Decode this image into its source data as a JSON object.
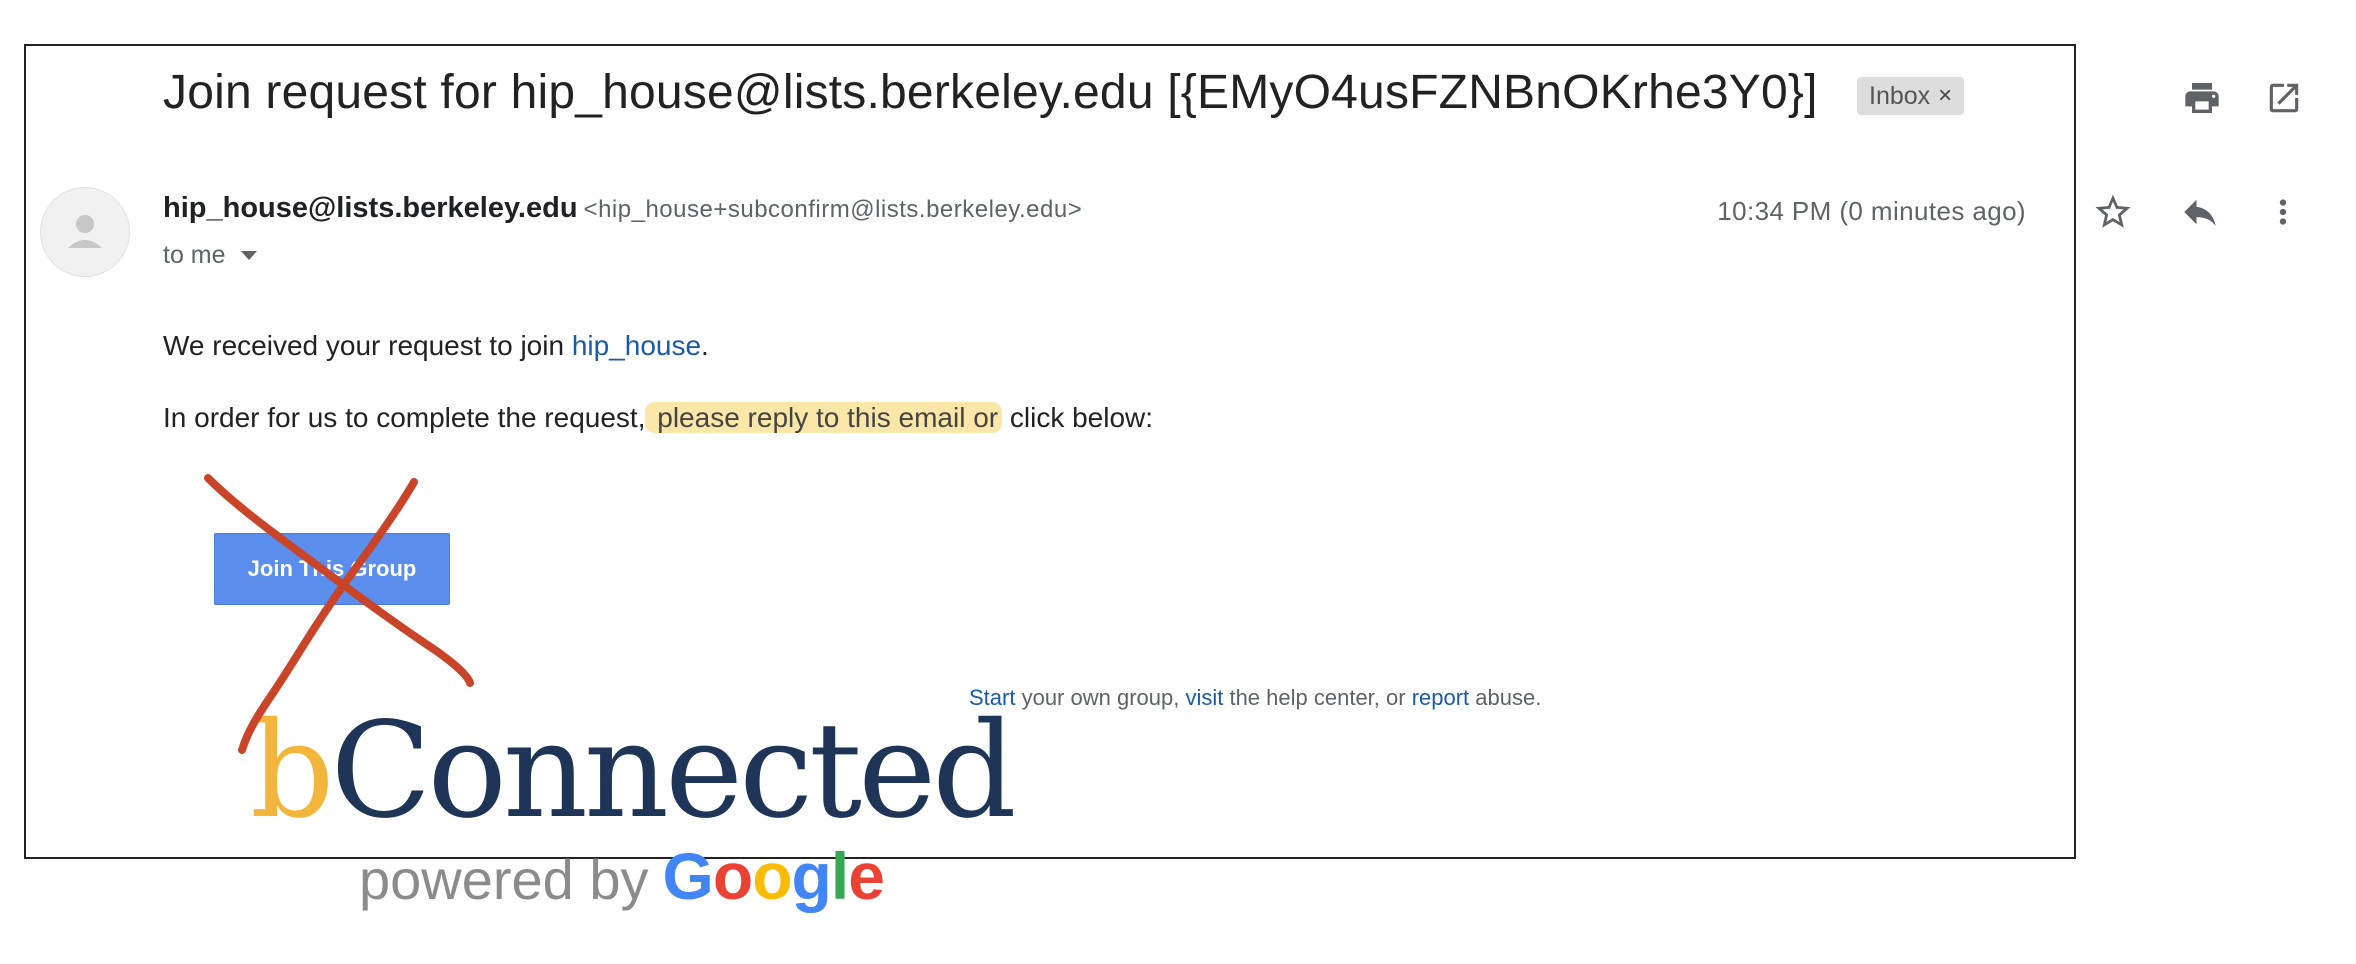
{
  "email": {
    "subject": "Join request for hip_house@lists.berkeley.edu [{EMyO4usFZNBnOKrhe3Y0}]",
    "label_chip": {
      "label": "Inbox",
      "close": "×"
    },
    "sender": {
      "name": "hip_house@lists.berkeley.edu",
      "email": "<hip_house+subconfirm@lists.berkeley.edu>"
    },
    "recipient": "to me",
    "timestamp": "10:34 PM (0 minutes ago)",
    "body": {
      "line1_prefix": "We received your request to join ",
      "line1_link": "hip_house",
      "line1_suffix": ".",
      "line2_prefix": "In order for us to complete the request,",
      "line2_highlight": " please reply to this email or",
      "line2_suffix": " click below:"
    },
    "join_button_label": "Join This Group",
    "footer": {
      "start_link": "Start",
      "text1": " your own group, ",
      "visit_link": "visit",
      "text2": " the help center, or ",
      "report_link": "report",
      "text3": " abuse."
    },
    "logo": {
      "b": "b",
      "connected": "Connected",
      "powered_by": "powered by",
      "google_letters": [
        "G",
        "o",
        "o",
        "g",
        "l",
        "e"
      ]
    }
  },
  "icons": [
    "print-icon",
    "open-in-new-window-icon",
    "star-icon",
    "reply-icon",
    "more-vert-icon",
    "avatar-person-icon",
    "dropdown-arrow-icon"
  ],
  "colors": {
    "link": "#1a5aa8",
    "highlight": "#fbe7a8",
    "join_button": "#5b8ded",
    "scribble": "#c9452a",
    "google_blue": "#4285f4",
    "google_red": "#ea4335",
    "google_yellow": "#fbbc05",
    "google_green": "#34a853"
  }
}
